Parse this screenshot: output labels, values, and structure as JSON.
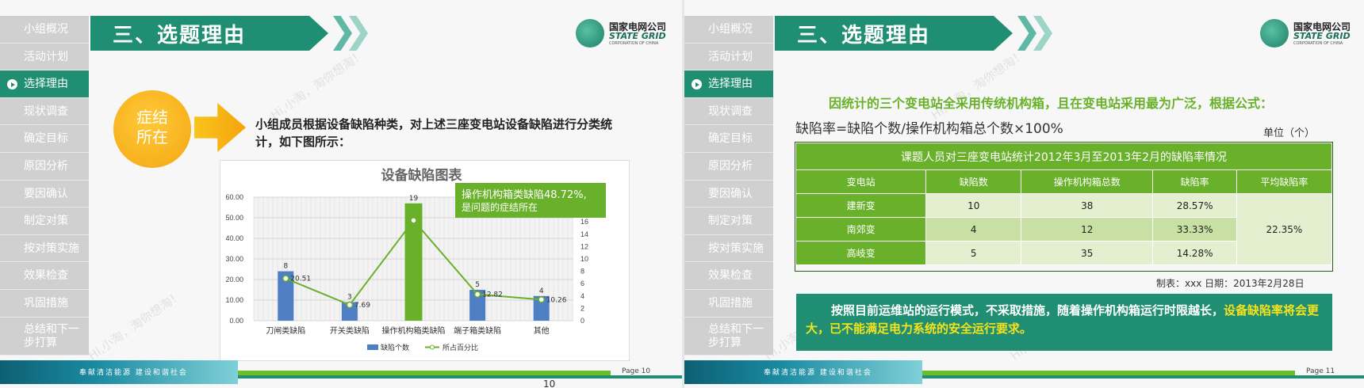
{
  "sidebar_items": [
    "小组概况",
    "活动计划",
    "选择理由",
    "现状调查",
    "确定目标",
    "原因分析",
    "要因确认",
    "制定对策",
    "按对策实施",
    "效果检查",
    "巩固措施",
    "总结和下一步打算"
  ],
  "header": {
    "title": "三、选题理由"
  },
  "logo": {
    "cn": "国家电网公司",
    "en": "STATE GRID",
    "sub": "CORPORATION OF CHINA"
  },
  "footer": {
    "slogan": "奉献清洁能源  建设和谐社会",
    "page1": "Page 10",
    "page2": "Page 11",
    "slide_number": "10"
  },
  "watermark": "Hi,小淘，淘你想淘！",
  "slide1": {
    "circle_text_1": "症结",
    "circle_text_2": "所在",
    "description": "小组成员根据设备缺陷种类，对上述三座变电站设备缺陷进行分类统计，如下图所示：",
    "callout_line1": "操作机构箱类缺陷48.72%,",
    "callout_line2": "是问题的症结所在"
  },
  "chart_data": {
    "type": "bar",
    "title": "设备缺陷图表",
    "categories": [
      "刀闸类缺陷",
      "开关类缺陷",
      "操作机构箱类缺陷",
      "端子箱类缺陷",
      "其他"
    ],
    "series": [
      {
        "name": "缺陷个数",
        "type": "bar",
        "axis": "right",
        "values": [
          8,
          3,
          19,
          5,
          4
        ],
        "color": "#4e7fc4"
      },
      {
        "name": "所占百分比",
        "type": "line",
        "axis": "left",
        "values": [
          20.51,
          7.69,
          48.72,
          12.82,
          10.26
        ],
        "color": "#6ab12b"
      }
    ],
    "highlight_color": "#6ab12b",
    "left_ticks": [
      "0.00",
      "10.00",
      "20.00",
      "30.00",
      "40.00",
      "50.00",
      "60.00"
    ],
    "left_ylim": [
      0,
      60
    ],
    "right_ticks": [
      "0",
      "2",
      "4",
      "6",
      "8",
      "10",
      "12",
      "14",
      "16",
      "18",
      "20"
    ],
    "right_ylim": [
      0,
      20
    ],
    "legend_position": "bottom",
    "grid": true
  },
  "slide2": {
    "intro": "因统计的三个变电站全采用传统机构箱，且在变电站采用最为广泛，根据公式：",
    "formula": "缺陷率=缺陷个数/操作机构箱总个数×100%",
    "unit": "单位（个）",
    "table_caption": "课题人员对三座变电站统计2012年3月至2013年2月的缺陷率情况",
    "headers": [
      "变电站",
      "缺陷数",
      "操作机构箱总数",
      "缺陷率",
      "平均缺陷率"
    ],
    "rows": [
      [
        "建新变",
        "10",
        "38",
        "28.57%"
      ],
      [
        "南郊变",
        "4",
        "12",
        "33.33%"
      ],
      [
        "高岐变",
        "5",
        "35",
        "14.28%"
      ]
    ],
    "average": "22.35%",
    "made_by": "制表：xxx  日期：2013年2月28日",
    "note_normal": "按照目前运维站的运行模式，不采取措施，随着操作机构箱运行时限越长，",
    "note_highlight": "设备缺陷率将会更大，已不能满足电力系统的安全运行要求。"
  }
}
